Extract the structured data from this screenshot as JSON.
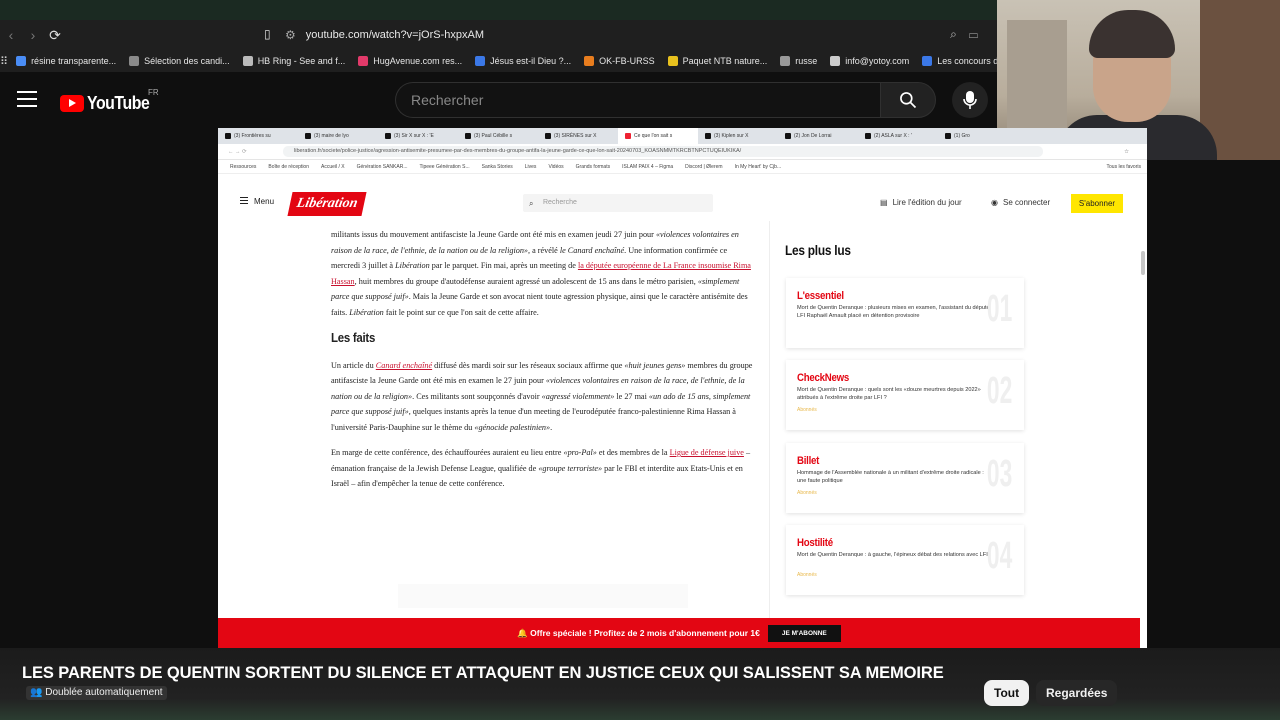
{
  "browser": {
    "url": "youtube.com/watch?v=jOrS-hxpxAM",
    "bookmarks": [
      {
        "label": "résine transparente...",
        "color": "#4a8df6"
      },
      {
        "label": "Sélection des candi...",
        "color": "#8a8a8a"
      },
      {
        "label": "HB Ring - See and f...",
        "color": "#bbbbbb"
      },
      {
        "label": "HugAvenue.com res...",
        "color": "#e23a6a"
      },
      {
        "label": "Jésus est-il Dieu ?...",
        "color": "#3b78e7"
      },
      {
        "label": "OK-FB-URSS",
        "color": "#e87d1e"
      },
      {
        "label": "Paquet NTB nature...",
        "color": "#e8c11e"
      },
      {
        "label": "russe",
        "color": "#999999"
      },
      {
        "label": "info@yotoy.com",
        "color": "#cccccc"
      },
      {
        "label": "Les concours d'",
        "color": "#3b78e7"
      }
    ]
  },
  "youtube": {
    "logo_text": "YouTube",
    "region": "FR",
    "search_placeholder": "Rechercher",
    "video_title": "LES PARENTS DE QUENTIN SORTENT DU SILENCE ET ATTAQUENT EN JUSTICE CEUX QUI SALISSENT SA MEMOIRE",
    "dubbed_label": "Doublée automatiquement",
    "chips": [
      "Tout",
      "Regardées"
    ]
  },
  "inner": {
    "tabs": [
      "(3) Frontières su",
      "(3) maire de lyo",
      "(3) Sir X sur X : 'E",
      "(3) Paul Cébille s",
      "(3) SIRÈNES sur X",
      "Ce que l'on sait s",
      "(3) Kiplen sur X",
      "(2) Jon De Lorrai",
      "(2) ASLA sur X : '",
      "(1) Gro"
    ],
    "url": "liberation.fr/societe/police-justice/agression-antisemite-presumee-par-des-membres-du-groupe-antifa-la-jeune-garde-ce-que-lon-sait-20240703_KOASNMMTKRCBTNPCTUQEIUKIKA/",
    "bookmarks": [
      "Ressources",
      "Boîte de réception",
      "Accueil / X",
      "Génération SANKAR...",
      "Tipeee Génération S...",
      "Sanka Stories",
      "Lives",
      "Vidéos",
      "Grands formats",
      "ISLAM PAIX 4 – Figma",
      "Discord | Ølerem",
      "In My Heart' by Cjb..."
    ],
    "bookmarks_right": "Tous les favoris"
  },
  "liberation": {
    "menu": "Menu",
    "logo": "Libération",
    "search_placeholder": "Recherche",
    "edition_link": "Lire l'édition du jour",
    "login_link": "Se connecter",
    "subscribe": "S'abonner",
    "p1": {
      "a": "militants issus du mouvement antifasciste la Jeune Garde ont été mis en examen jeudi 27 juin pour ",
      "b": "«violences volontaires en raison de la race, de l'ethnie, de la nation ou de la religion»",
      "c": ", a révélé ",
      "d": "le Canard enchaîné",
      "e": ". Une information confirmée ce mercredi 3 juillet à ",
      "f": "Libération",
      "g": " par le parquet. Fin mai, après un meeting de ",
      "h": "la députée européenne de La France insoumise Rima Hassan",
      "i": ", huit membres du groupe d'autodéfense auraient agressé un adolescent de 15 ans dans le métro parisien, ",
      "j": "«simplement parce que supposé juif»",
      "k": ". Mais la Jeune Garde et son avocat nient toute agression physique, ainsi que le caractère antisémite des faits. ",
      "l": "Libération",
      "m": " fait le point sur ce que l'on sait de cette affaire."
    },
    "heading": "Les faits",
    "p2": {
      "a": "Un article du ",
      "b": "Canard enchaîné",
      "c": " diffusé dès mardi soir sur les réseaux sociaux affirme que ",
      "d": "«huit jeunes gens»",
      "e": " membres du groupe antifasciste la Jeune Garde ont été mis en examen le 27 juin pour ",
      "f": "«violences volontaires en raison de la race, de l'ethnie, de la nation ou de la religion»",
      "g": ". Ces militants sont soupçonnés d'avoir ",
      "h": "«agressé violemment»",
      "i": " le 27 mai ",
      "j": "«un ado de 15 ans, simplement parce que supposé juif»",
      "k": ", quelques instants après la tenue d'un meeting de l'eurodéputée franco-palestinienne Rima Hassan à l'université Paris-Dauphine sur le thème du ",
      "l": "«génocide palestinien»",
      "m": "."
    },
    "p3": {
      "a": "En marge de cette conférence, des échauffourées auraient eu lieu entre ",
      "b": "«pro-Pal»",
      "c": " et des membres de la ",
      "d": "Ligue de défense juive",
      "e": " – émanation française de la Jewish Defense League, qualifiée de ",
      "f": "«groupe terroriste»",
      "g": " par le FBI et interdite aux Etats-Unis et en Israël – afin d'empêcher la tenue de cette conférence."
    },
    "most_read_title": "Les plus lus",
    "most_read": [
      {
        "category": "L'essentiel",
        "text": "Mort de Quentin Deranque : plusieurs mises en examen, l'assistant du député LFI Raphaël Arnault placé en détention provisoire",
        "sub": "",
        "num": "01"
      },
      {
        "category": "CheckNews",
        "text": "Mort de Quentin Deranque : quels sont les «douze meurtres depuis 2022» attribués à l'extrême droite par LFI ?",
        "sub": "Abonnés",
        "num": "02"
      },
      {
        "category": "Billet",
        "text": "Hommage de l'Assemblée nationale à un militant d'extrême droite radicale : une faute politique",
        "sub": "Abonnés",
        "num": "03"
      },
      {
        "category": "Hostilité",
        "text": "Mort de Quentin Deranque : à gauche, l'épineux débat des relations avec LFI",
        "sub": "Abonnés",
        "num": "04"
      }
    ],
    "offer_text": "🔔 Offre spéciale ! Profitez de 2 mois d'abonnement pour 1€",
    "offer_cta": "JE M'ABONNE"
  }
}
